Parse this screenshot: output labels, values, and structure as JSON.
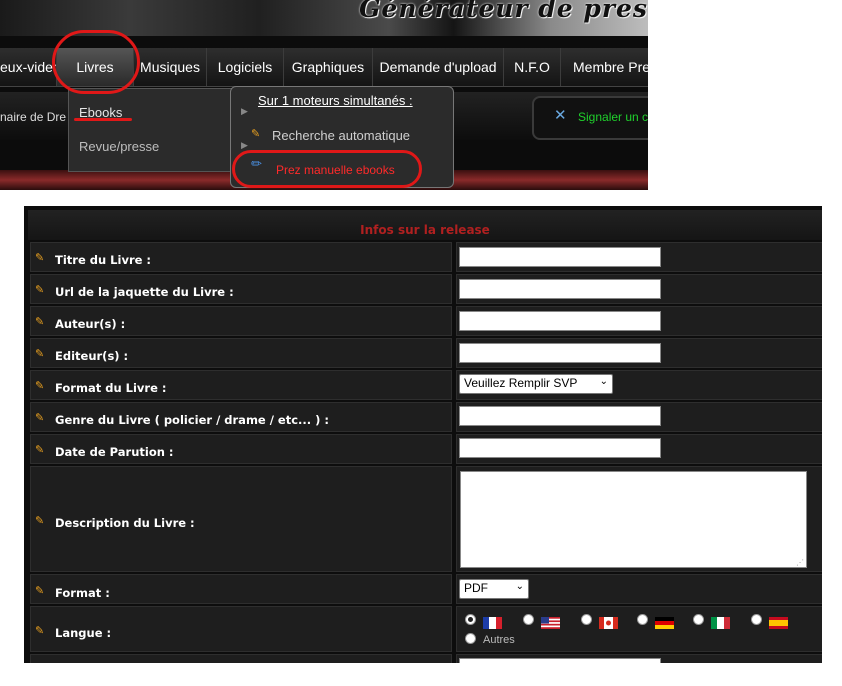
{
  "banner": {
    "title": "Générateur de pres"
  },
  "nav": {
    "items": [
      {
        "label": "eux-video"
      },
      {
        "label": "Livres"
      },
      {
        "label": "Musiques"
      },
      {
        "label": "Logiciels"
      },
      {
        "label": "Graphiques"
      },
      {
        "label": "Demande d'upload"
      },
      {
        "label": "N.F.O"
      },
      {
        "label": "Membre Prez"
      }
    ]
  },
  "subbar": {
    "left_text": "naire de Dre",
    "signal_text": "Signaler un c"
  },
  "dropdown": {
    "items": [
      "Ebooks",
      "Revue/presse"
    ]
  },
  "submenu": {
    "title": "Sur 1 moteurs simultanés :",
    "items": [
      "Recherche automatique",
      "Prez manuelle ebooks"
    ]
  },
  "form": {
    "header": "Infos sur la release",
    "rows": [
      {
        "label": "Titre du Livre :"
      },
      {
        "label": "Url de la jaquette du Livre :"
      },
      {
        "label": "Auteur(s) :"
      },
      {
        "label": "Editeur(s) :"
      },
      {
        "label": "Format du Livre :",
        "select": "Veuillez Remplir SVP"
      },
      {
        "label": "Genre du Livre ( policier / drame / etc... ) :"
      },
      {
        "label": "Date de Parution :"
      },
      {
        "label": "Description du Livre :"
      },
      {
        "label": "Format :",
        "select": "PDF"
      },
      {
        "label": "Langue :",
        "other_label": "Autres"
      }
    ]
  },
  "colors": {
    "accent_red": "#e01818",
    "signal_green": "#1fd12c",
    "header_red": "#b02020"
  }
}
